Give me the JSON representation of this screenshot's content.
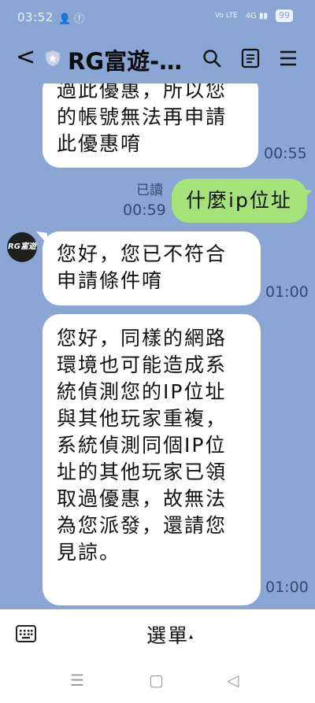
{
  "status_bar": {
    "time": "03:52",
    "left_icons": [
      "person-icon",
      "facebook-icon"
    ],
    "network": "Vo LTE",
    "signal": "4G",
    "battery": "99"
  },
  "header": {
    "title": "RG富遊-…",
    "icons": [
      "back-arrow-icon",
      "shield-icon",
      "search-icon",
      "notes-icon",
      "hamburger-menu-icon"
    ]
  },
  "messages": [
    {
      "sender": "other",
      "lines": [
        "過此優惠，所以您",
        "的帳號無法再申請",
        "此優惠唷"
      ],
      "time": "00:55"
    },
    {
      "sender": "me",
      "lines": [
        "什麼ip位址"
      ],
      "read": "已讀",
      "time": "00:59"
    },
    {
      "sender": "other",
      "avatar_text": "RG富遊",
      "lines": [
        "您好，您已不符合",
        "申請條件唷"
      ],
      "time": "01:00"
    },
    {
      "sender": "other",
      "lines": [
        "您好，同樣的網路",
        "環境也可能造成系",
        "統偵測您的IP位址",
        "與其他玩家重複，",
        "系統偵測同個IP位",
        "址的其他玩家已領",
        "取過優惠，故無法",
        "為您派發，還請您",
        "見諒。"
      ],
      "time": "01:00"
    }
  ],
  "bottom_bar": {
    "menu_label": "選單",
    "menu_caret": "▴",
    "nav": {
      "recent": "☰",
      "home": "▢",
      "back": "◁"
    }
  },
  "colors": {
    "chat_background": "#8aa6d4",
    "my_bubble": "#a6e27a",
    "other_bubble": "#ffffff"
  }
}
